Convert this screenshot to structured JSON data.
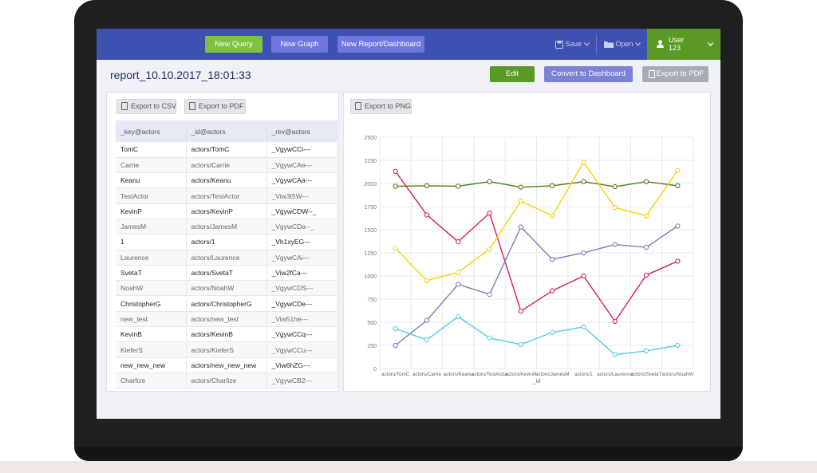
{
  "nav": {
    "new_query": "New Query",
    "new_graph": "New Graph",
    "new_report": "New Report/Dashboard",
    "save": "Save",
    "open": "Open",
    "user_label": "User",
    "user_id": "123"
  },
  "report": {
    "title": "report_10.10.2017_18:01:33",
    "edit": "Edit",
    "convert": "Convert to Dashboard",
    "export_pdf": "Export to PDF"
  },
  "table_panel": {
    "export_csv": "Export to CSV",
    "export_pdf": "Export to PDF",
    "headers": [
      "_key@actors",
      "_id@actors",
      "_rev@actors"
    ],
    "rows": [
      [
        "TomC",
        "actors/TomC",
        "_VgywCCi---"
      ],
      [
        "Carrie",
        "actors/Carrie",
        "_VgywCAe---"
      ],
      [
        "Keanu",
        "actors/Keanu",
        "_VgywCAa---"
      ],
      [
        "TestActor",
        "actors/TestActor",
        "_Viw3t5W---"
      ],
      [
        "KevinP",
        "actors/KevinP",
        "_VgywCDW--_"
      ],
      [
        "JamesM",
        "actors/JamesM",
        "_VgywCDa--_"
      ],
      [
        "1",
        "actors/1",
        "_Vh1xyEG---"
      ],
      [
        "Laurence",
        "actors/Laurence",
        "_VgywCAi---"
      ],
      [
        "SvetaT",
        "actors/SvetaT",
        "_Viw2fCa---"
      ],
      [
        "NoahW",
        "actors/NoahW",
        "_VgywCDS---"
      ],
      [
        "ChristopherG",
        "actors/ChristopherG",
        "_VgywCDe---"
      ],
      [
        "new_test",
        "actors/new_test",
        "_Viw51he---"
      ],
      [
        "KevinB",
        "actors/KevinB",
        "_VgywCCq---"
      ],
      [
        "KieferS",
        "actors/KieferS",
        "_VgywCCu---"
      ],
      [
        "new_new_new",
        "actors/new_new_new",
        "_Viw6hZG---"
      ],
      [
        "Charlize",
        "actors/Charlize",
        "_VgywCB2---"
      ]
    ]
  },
  "chart_panel": {
    "export_png": "Export to PNG"
  },
  "chart_data": {
    "type": "line",
    "xlabel": "_id",
    "ylabel": "",
    "ylim": [
      0,
      2500
    ],
    "yticks": [
      0,
      250,
      500,
      750,
      1000,
      1250,
      1500,
      1750,
      2000,
      2250,
      2500
    ],
    "grid": true,
    "categories": [
      "actors/TomC",
      "actors/Carrie",
      "actors/Keanu",
      "actors/TestActor",
      "actors/KevinP",
      "actors/JamesM",
      "actors/1",
      "actors/Laurence",
      "actors/SvetaT",
      "actors/NoahW"
    ],
    "tick_labels": [
      "actors/TomC",
      "actors/Carrie",
      "actors/Keanu",
      "actors/TestActor",
      "actors/KevinP",
      "actors/JamesM",
      "actors/1",
      "actors/Laurence",
      "actors/SvetaT",
      "actors/NoahW"
    ],
    "series": [
      {
        "color": "#4e7d14",
        "values": [
          1970,
          1975,
          1970,
          2020,
          1960,
          1975,
          2020,
          1965,
          2020,
          1975
        ]
      },
      {
        "color": "#d81b60",
        "values": [
          2130,
          1660,
          1370,
          1680,
          620,
          840,
          1000,
          510,
          1010,
          1160
        ]
      },
      {
        "color": "#f5d300",
        "values": [
          1300,
          950,
          1040,
          1290,
          1810,
          1650,
          2230,
          1740,
          1650,
          2140
        ]
      },
      {
        "color": "#7580b8",
        "values": [
          250,
          520,
          910,
          800,
          1530,
          1180,
          1250,
          1340,
          1310,
          1540
        ]
      },
      {
        "color": "#5bc8e8",
        "values": [
          430,
          310,
          560,
          330,
          260,
          390,
          450,
          150,
          190,
          250
        ]
      }
    ]
  }
}
